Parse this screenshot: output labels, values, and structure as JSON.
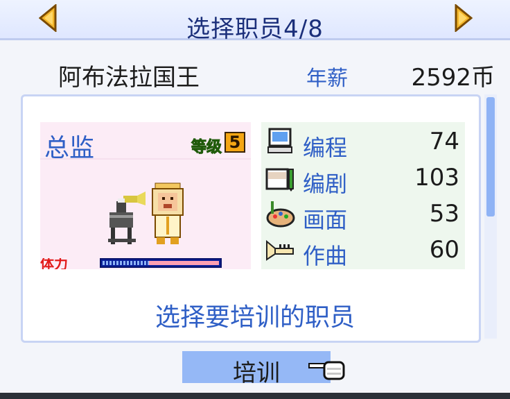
{
  "header": {
    "title": "选择职员4/8",
    "prev_icon": "triangle-left-icon",
    "next_icon": "triangle-right-icon"
  },
  "employee": {
    "name": "阿布法拉国王",
    "salary_label": "年薪",
    "salary_value": "2592币",
    "job_title": "总监",
    "level_label": "等级",
    "level_value": "5",
    "stamina_label": "体力",
    "stamina_fraction": 0.4
  },
  "skills": [
    {
      "label": "编程",
      "value": "74",
      "icon": "computer-icon"
    },
    {
      "label": "编剧",
      "value": "103",
      "icon": "book-pen-icon"
    },
    {
      "label": "画面",
      "value": "53",
      "icon": "palette-icon"
    },
    {
      "label": "作曲",
      "value": "60",
      "icon": "trumpet-icon"
    }
  ],
  "prompt": "选择要培训的职员",
  "train_button": {
    "label": "培训"
  },
  "colors": {
    "accent_blue": "#2f5fc6",
    "title_navy": "#1b2f7a",
    "button_blue": "#95b8f6",
    "stamina_red": "#e21a1a"
  }
}
